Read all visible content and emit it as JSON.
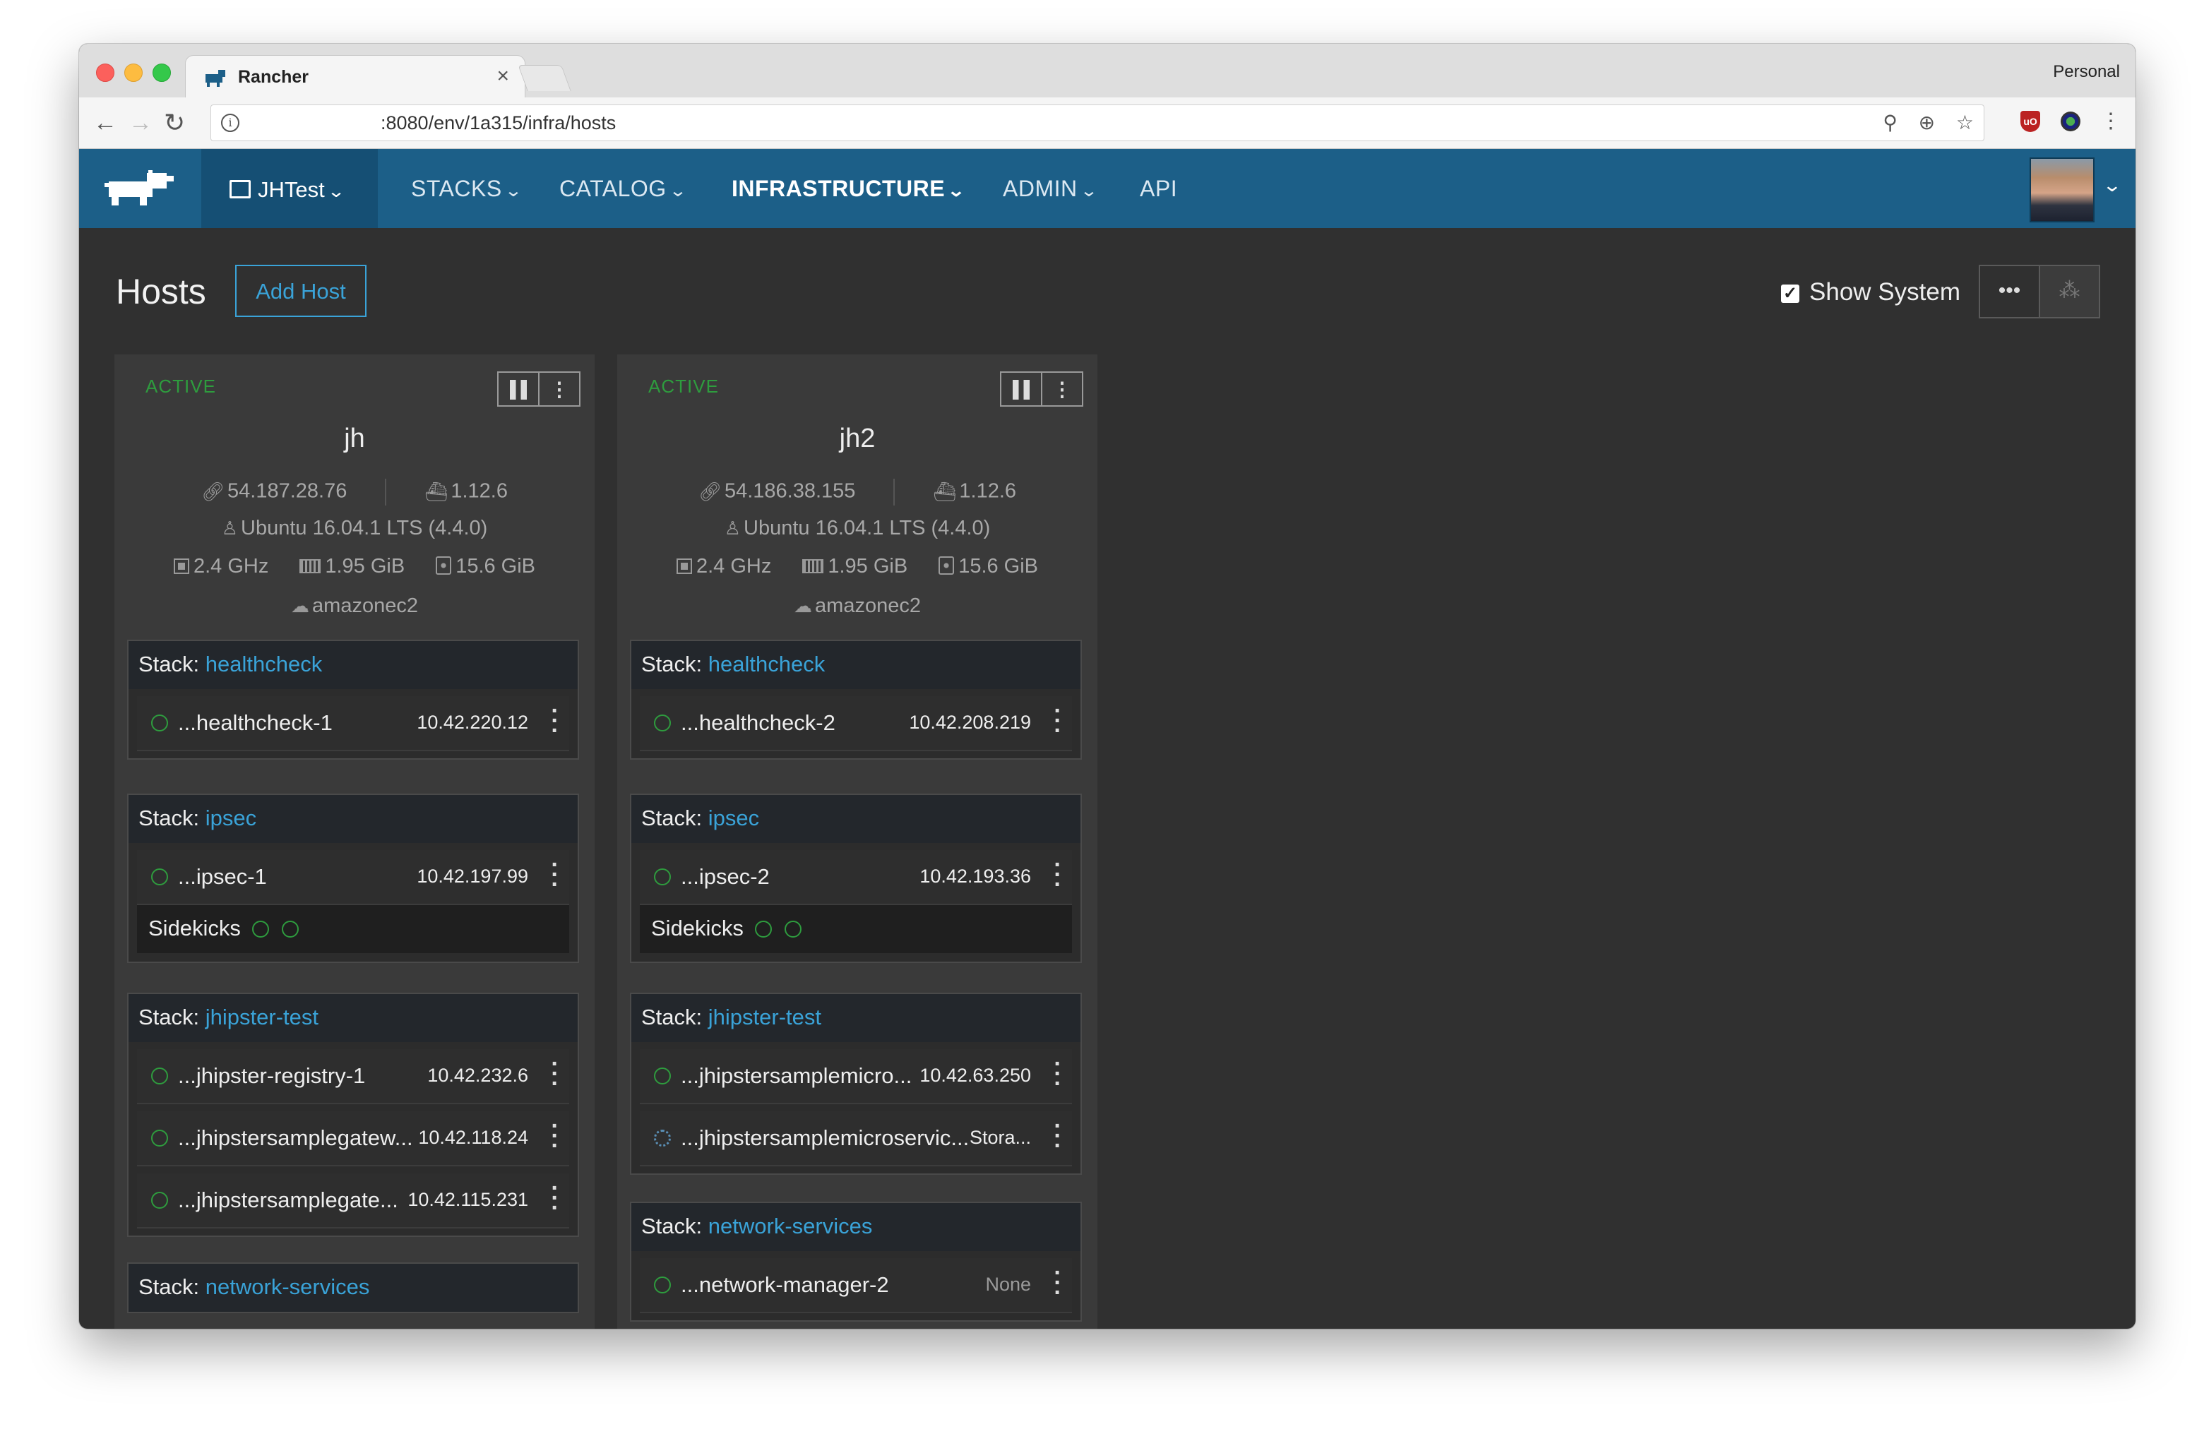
{
  "browser": {
    "tab_title": "Rancher",
    "tab_close": "×",
    "profile": "Personal",
    "url": ":8080/env/1a315/infra/hosts"
  },
  "appbar": {
    "environment": "JHTest",
    "menu": [
      {
        "label": "STACKS"
      },
      {
        "label": "CATALOG"
      },
      {
        "label": "INFRASTRUCTURE"
      },
      {
        "label": "ADMIN"
      },
      {
        "label": "API"
      }
    ],
    "accent_color": "#1c5f88"
  },
  "page": {
    "title": "Hosts",
    "add_host": "Add Host",
    "show_system": "Show System",
    "more": "•••"
  },
  "hosts": [
    {
      "state": "ACTIVE",
      "name": "jh",
      "ip": "54.187.28.76",
      "docker": "1.12.6",
      "os": "Ubuntu 16.04.1 LTS (4.4.0)",
      "cpu": "2.4 GHz",
      "memory": "1.95 GiB",
      "storage": "15.6 GiB",
      "driver": "amazonec2",
      "stacks": [
        {
          "prefix": "Stack:",
          "name": "healthcheck",
          "containers": [
            {
              "name": "...healthcheck-1",
              "ip": "10.42.220.12"
            }
          ]
        },
        {
          "prefix": "Stack:",
          "name": "ipsec",
          "containers": [
            {
              "name": "...ipsec-1",
              "ip": "10.42.197.99"
            }
          ],
          "sidekicks": "Sidekicks"
        },
        {
          "prefix": "Stack:",
          "name": "jhipster-test",
          "containers": [
            {
              "name": "...jhipster-registry-1",
              "ip": "10.42.232.6"
            },
            {
              "name": "...jhipstersamplegatew...",
              "ip": "10.42.118.24"
            },
            {
              "name": "...jhipstersamplegate...",
              "ip": "10.42.115.231"
            }
          ]
        },
        {
          "prefix": "Stack:",
          "name": "network-services",
          "containers": []
        }
      ]
    },
    {
      "state": "ACTIVE",
      "name": "jh2",
      "ip": "54.186.38.155",
      "docker": "1.12.6",
      "os": "Ubuntu 16.04.1 LTS (4.4.0)",
      "cpu": "2.4 GHz",
      "memory": "1.95 GiB",
      "storage": "15.6 GiB",
      "driver": "amazonec2",
      "stacks": [
        {
          "prefix": "Stack:",
          "name": "healthcheck",
          "containers": [
            {
              "name": "...healthcheck-2",
              "ip": "10.42.208.219"
            }
          ]
        },
        {
          "prefix": "Stack:",
          "name": "ipsec",
          "containers": [
            {
              "name": "...ipsec-2",
              "ip": "10.42.193.36"
            }
          ],
          "sidekicks": "Sidekicks"
        },
        {
          "prefix": "Stack:",
          "name": "jhipster-test",
          "containers": [
            {
              "name": "...jhipstersamplemicro...",
              "ip": "10.42.63.250"
            },
            {
              "name": "...jhipstersamplemicroservic...",
              "ip": "Stora..."
            }
          ]
        },
        {
          "prefix": "Stack:",
          "name": "network-services",
          "containers": [
            {
              "name": "...network-manager-2",
              "ip": "None"
            }
          ]
        }
      ]
    }
  ]
}
